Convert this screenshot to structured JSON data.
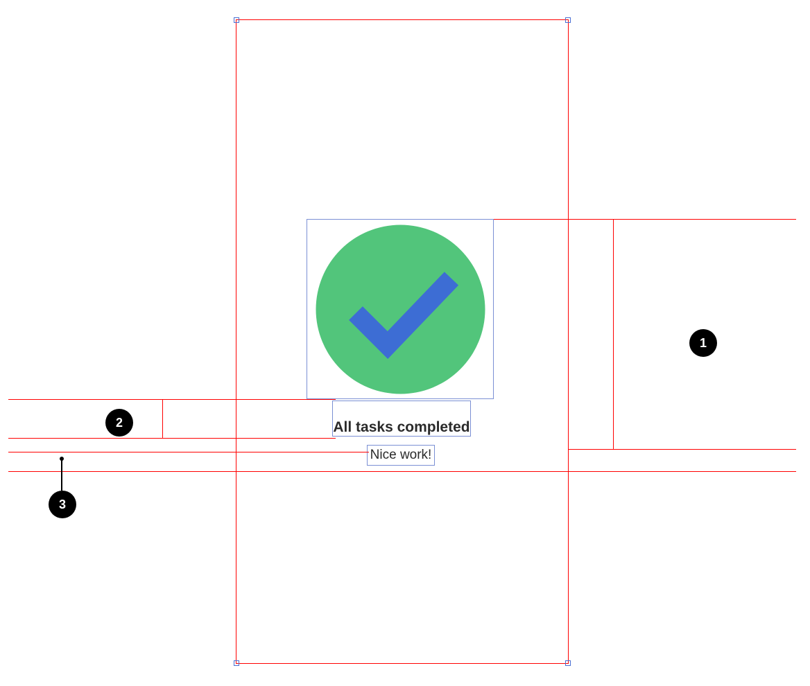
{
  "screen": {
    "title": "All tasks completed",
    "subtitle": "Nice work!",
    "icon": "success-check"
  },
  "annotations": {
    "badges": [
      "1",
      "2",
      "3"
    ]
  },
  "colors": {
    "circle_fill": "#52c57b",
    "check_stroke": "#3d6dd4",
    "annotation_line": "#ff0000",
    "selection_box": "#7a8fd4"
  }
}
